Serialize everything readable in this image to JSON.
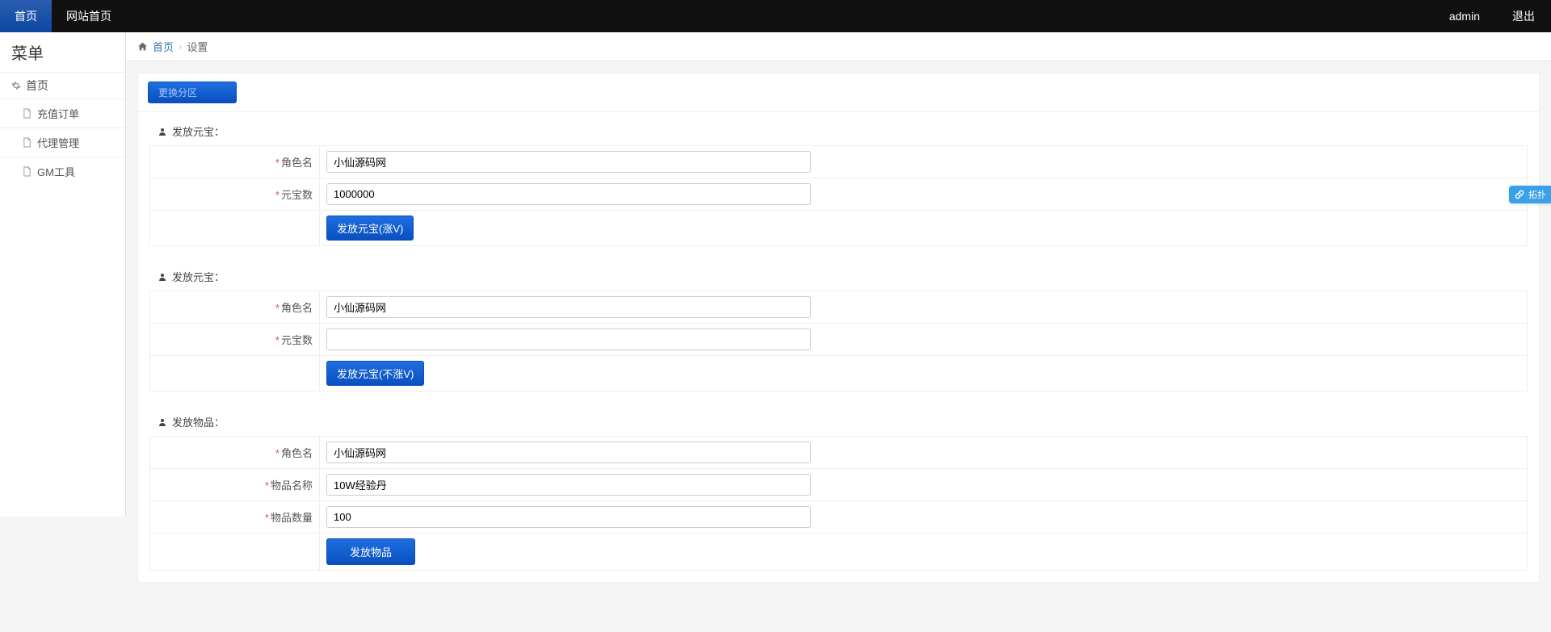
{
  "topnav": {
    "tab_home": "首页",
    "tab_site": "网站首页",
    "user": "admin",
    "logout": "退出"
  },
  "sidebar": {
    "heading": "菜单",
    "root": "首页",
    "items": [
      {
        "label": "充值订单"
      },
      {
        "label": "代理管理"
      },
      {
        "label": "GM工具"
      }
    ]
  },
  "breadcrumb": {
    "home": "首页",
    "current": "设置"
  },
  "panel": {
    "change_zone": "更换分区"
  },
  "forms": {
    "yuanbao_v": {
      "title": "发放元宝：",
      "role_label": "角色名",
      "role_value": "小仙源码网",
      "amount_label": "元宝数",
      "amount_value": "1000000",
      "submit": "发放元宝(涨V)"
    },
    "yuanbao_nov": {
      "title": "发放元宝：",
      "role_label": "角色名",
      "role_value": "小仙源码网",
      "amount_label": "元宝数",
      "amount_value": "",
      "submit": "发放元宝(不涨V)"
    },
    "item": {
      "title": "发放物品：",
      "role_label": "角色名",
      "role_value": "小仙源码网",
      "name_label": "物品名称",
      "name_value": "10W经验丹",
      "qty_label": "物品数量",
      "qty_value": "100",
      "submit": "发放物品"
    }
  },
  "float_widget": {
    "label": "拓扑"
  }
}
